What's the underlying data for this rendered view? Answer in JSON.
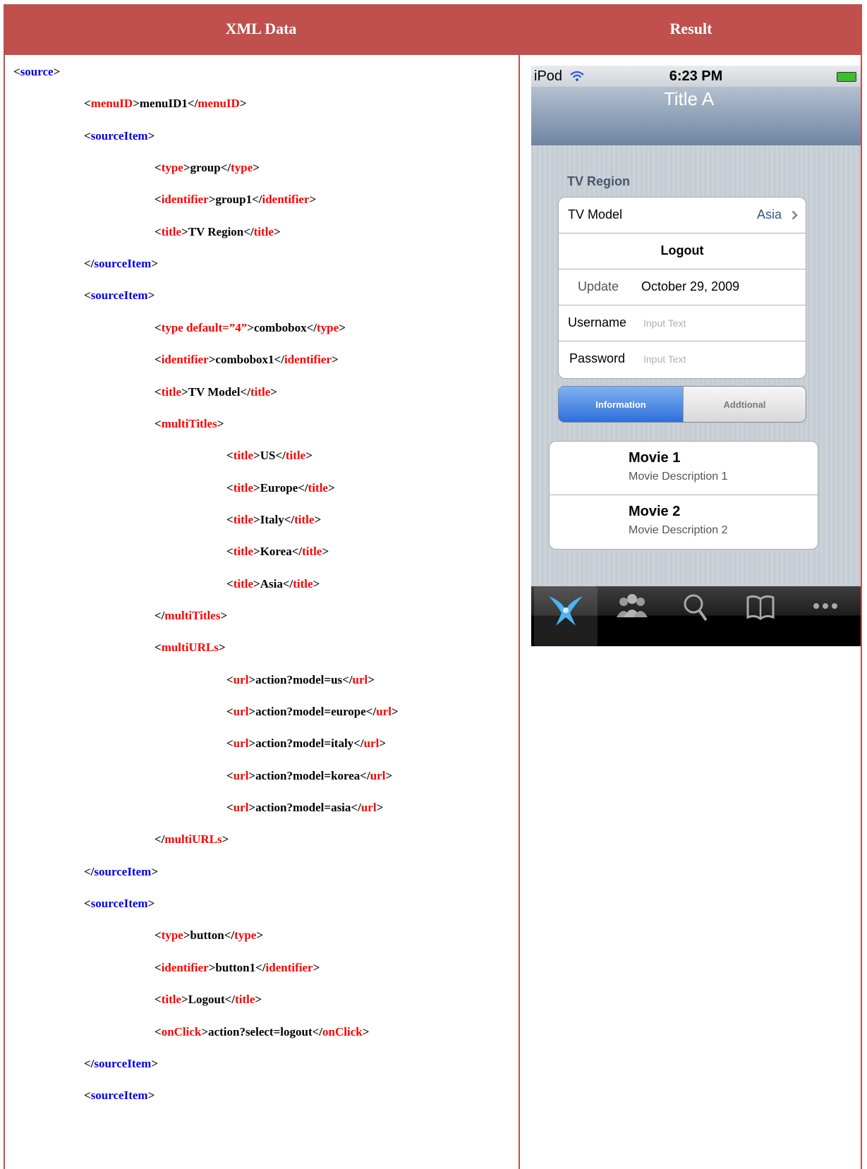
{
  "headers": {
    "left": "XML Data",
    "right": "Result"
  },
  "xml_lines": [
    {
      "indent": 0,
      "parts": [
        [
          "k",
          "<"
        ],
        [
          "b",
          "source"
        ],
        [
          "k",
          ">"
        ]
      ]
    },
    {
      "indent": 1,
      "parts": [
        [
          "k",
          "<"
        ],
        [
          "r",
          "menuID"
        ],
        [
          "k",
          ">menuID1</"
        ],
        [
          "r",
          "menuID"
        ],
        [
          "k",
          ">"
        ]
      ]
    },
    {
      "indent": 1,
      "parts": [
        [
          "k",
          "<"
        ],
        [
          "b",
          "sourceItem"
        ],
        [
          "k",
          ">"
        ]
      ]
    },
    {
      "indent": 2,
      "parts": [
        [
          "k",
          "<"
        ],
        [
          "r",
          "type"
        ],
        [
          "k",
          ">group</"
        ],
        [
          "r",
          "type"
        ],
        [
          "k",
          ">"
        ]
      ]
    },
    {
      "indent": 2,
      "parts": [
        [
          "k",
          "<"
        ],
        [
          "r",
          "identifier"
        ],
        [
          "k",
          ">group1</"
        ],
        [
          "r",
          "identifier"
        ],
        [
          "k",
          ">"
        ]
      ]
    },
    {
      "indent": 2,
      "parts": [
        [
          "k",
          "<"
        ],
        [
          "r",
          "title"
        ],
        [
          "k",
          ">TV Region</"
        ],
        [
          "r",
          "title"
        ],
        [
          "k",
          ">"
        ]
      ]
    },
    {
      "indent": 1,
      "parts": [
        [
          "k",
          "</"
        ],
        [
          "b",
          "sourceItem"
        ],
        [
          "k",
          ">"
        ]
      ]
    },
    {
      "indent": 1,
      "parts": [
        [
          "k",
          "<"
        ],
        [
          "b",
          "sourceItem"
        ],
        [
          "k",
          ">"
        ]
      ]
    },
    {
      "indent": 2,
      "parts": [
        [
          "k",
          "<"
        ],
        [
          "r",
          "type default=”4”"
        ],
        [
          "k",
          ">combobox</"
        ],
        [
          "r",
          "type"
        ],
        [
          "k",
          ">"
        ]
      ]
    },
    {
      "indent": 2,
      "parts": [
        [
          "k",
          "<"
        ],
        [
          "r",
          "identifier"
        ],
        [
          "k",
          ">combobox1</"
        ],
        [
          "r",
          "identifier"
        ],
        [
          "k",
          ">"
        ]
      ]
    },
    {
      "indent": 2,
      "parts": [
        [
          "k",
          "<"
        ],
        [
          "r",
          "title"
        ],
        [
          "k",
          ">TV Model</"
        ],
        [
          "r",
          "title"
        ],
        [
          "k",
          ">"
        ]
      ]
    },
    {
      "indent": 2,
      "parts": [
        [
          "k",
          "<"
        ],
        [
          "r",
          "multiTitles"
        ],
        [
          "k",
          ">"
        ]
      ]
    },
    {
      "indent": 3,
      "parts": [
        [
          "k",
          "<"
        ],
        [
          "r",
          "title"
        ],
        [
          "k",
          ">US</"
        ],
        [
          "r",
          "title"
        ],
        [
          "k",
          ">"
        ]
      ]
    },
    {
      "indent": 3,
      "parts": [
        [
          "k",
          "<"
        ],
        [
          "r",
          "title"
        ],
        [
          "k",
          ">Europe</"
        ],
        [
          "r",
          "title"
        ],
        [
          "k",
          ">"
        ]
      ]
    },
    {
      "indent": 3,
      "parts": [
        [
          "k",
          "<"
        ],
        [
          "r",
          "title"
        ],
        [
          "k",
          ">Italy</"
        ],
        [
          "r",
          "title"
        ],
        [
          "k",
          ">"
        ]
      ]
    },
    {
      "indent": 3,
      "parts": [
        [
          "k",
          "<"
        ],
        [
          "r",
          "title"
        ],
        [
          "k",
          ">Korea</"
        ],
        [
          "r",
          "title"
        ],
        [
          "k",
          ">"
        ]
      ]
    },
    {
      "indent": 3,
      "parts": [
        [
          "k",
          "<"
        ],
        [
          "r",
          "title"
        ],
        [
          "k",
          ">Asia</"
        ],
        [
          "r",
          "title"
        ],
        [
          "k",
          ">"
        ]
      ]
    },
    {
      "indent": 2,
      "parts": [
        [
          "k",
          "</"
        ],
        [
          "r",
          "multiTitles"
        ],
        [
          "k",
          ">"
        ]
      ]
    },
    {
      "indent": 2,
      "parts": [
        [
          "k",
          "<"
        ],
        [
          "r",
          "multiURLs"
        ],
        [
          "k",
          ">"
        ]
      ]
    },
    {
      "indent": 3,
      "parts": [
        [
          "k",
          "<"
        ],
        [
          "r",
          "url"
        ],
        [
          "k",
          ">action?model=us</"
        ],
        [
          "r",
          "url"
        ],
        [
          "k",
          ">"
        ]
      ]
    },
    {
      "indent": 3,
      "parts": [
        [
          "k",
          "<"
        ],
        [
          "r",
          "url"
        ],
        [
          "k",
          ">action?model=europe</"
        ],
        [
          "r",
          "url"
        ],
        [
          "k",
          ">"
        ]
      ]
    },
    {
      "indent": 3,
      "parts": [
        [
          "k",
          "<"
        ],
        [
          "r",
          "url"
        ],
        [
          "k",
          ">action?model=italy</"
        ],
        [
          "r",
          "url"
        ],
        [
          "k",
          ">"
        ]
      ]
    },
    {
      "indent": 3,
      "parts": [
        [
          "k",
          "<"
        ],
        [
          "r",
          "url"
        ],
        [
          "k",
          ">action?model=korea</"
        ],
        [
          "r",
          "url"
        ],
        [
          "k",
          ">"
        ]
      ]
    },
    {
      "indent": 3,
      "parts": [
        [
          "k",
          "<"
        ],
        [
          "r",
          "url"
        ],
        [
          "k",
          ">action?model=asia</"
        ],
        [
          "r",
          "url"
        ],
        [
          "k",
          ">"
        ]
      ]
    },
    {
      "indent": 2,
      "parts": [
        [
          "k",
          "</"
        ],
        [
          "r",
          "multiURLs"
        ],
        [
          "k",
          ">"
        ]
      ]
    },
    {
      "indent": 1,
      "parts": [
        [
          "k",
          "</"
        ],
        [
          "b",
          "sourceItem"
        ],
        [
          "k",
          ">"
        ]
      ]
    },
    {
      "indent": 1,
      "parts": [
        [
          "k",
          "<"
        ],
        [
          "b",
          "sourceItem"
        ],
        [
          "k",
          ">"
        ]
      ]
    },
    {
      "indent": 2,
      "parts": [
        [
          "k",
          "<"
        ],
        [
          "r",
          "type"
        ],
        [
          "k",
          ">button</"
        ],
        [
          "r",
          "type"
        ],
        [
          "k",
          ">"
        ]
      ]
    },
    {
      "indent": 2,
      "parts": [
        [
          "k",
          "<"
        ],
        [
          "r",
          "identifier"
        ],
        [
          "k",
          ">button1</"
        ],
        [
          "r",
          "identifier"
        ],
        [
          "k",
          ">"
        ]
      ]
    },
    {
      "indent": 2,
      "parts": [
        [
          "k",
          "<"
        ],
        [
          "r",
          "title"
        ],
        [
          "k",
          ">Logout</"
        ],
        [
          "r",
          "title"
        ],
        [
          "k",
          ">"
        ]
      ]
    },
    {
      "indent": 2,
      "parts": [
        [
          "k",
          "<"
        ],
        [
          "r",
          "onClick"
        ],
        [
          "k",
          ">action?select=logout</"
        ],
        [
          "r",
          "onClick"
        ],
        [
          "k",
          ">"
        ]
      ]
    },
    {
      "indent": 1,
      "parts": [
        [
          "k",
          "</"
        ],
        [
          "b",
          "sourceItem"
        ],
        [
          "k",
          ">"
        ]
      ]
    },
    {
      "indent": 1,
      "parts": [
        [
          "k",
          "<"
        ],
        [
          "b",
          "sourceItem"
        ],
        [
          "k",
          ">"
        ]
      ]
    }
  ],
  "phone": {
    "status": {
      "carrier": "iPod",
      "time": "6:23 PM"
    },
    "nav_title": "Title A",
    "group_title": "TV Region",
    "cells": {
      "tv_model_label": "TV Model",
      "tv_model_value": "Asia",
      "logout_label": "Logout",
      "update_label": "Update",
      "update_value": "October 29, 2009",
      "username_label": "Username",
      "username_placeholder": "Input Text",
      "password_label": "Password",
      "password_placeholder": "Input Text"
    },
    "segments": {
      "selected": "Information",
      "other": "Addtional"
    },
    "movies": [
      {
        "title": "Movie 1",
        "desc": "Movie Description 1"
      },
      {
        "title": "Movie 2",
        "desc": "Movie Description 2"
      }
    ],
    "tabs": [
      "featured-icon",
      "contacts-icon",
      "search-icon",
      "bookmarks-icon",
      "more-icon"
    ]
  },
  "colors": {
    "header": "#c0504d",
    "tag_blue": "#0000ee",
    "tag_red": "#ff0000",
    "segment_active": "#2e6fdb"
  }
}
